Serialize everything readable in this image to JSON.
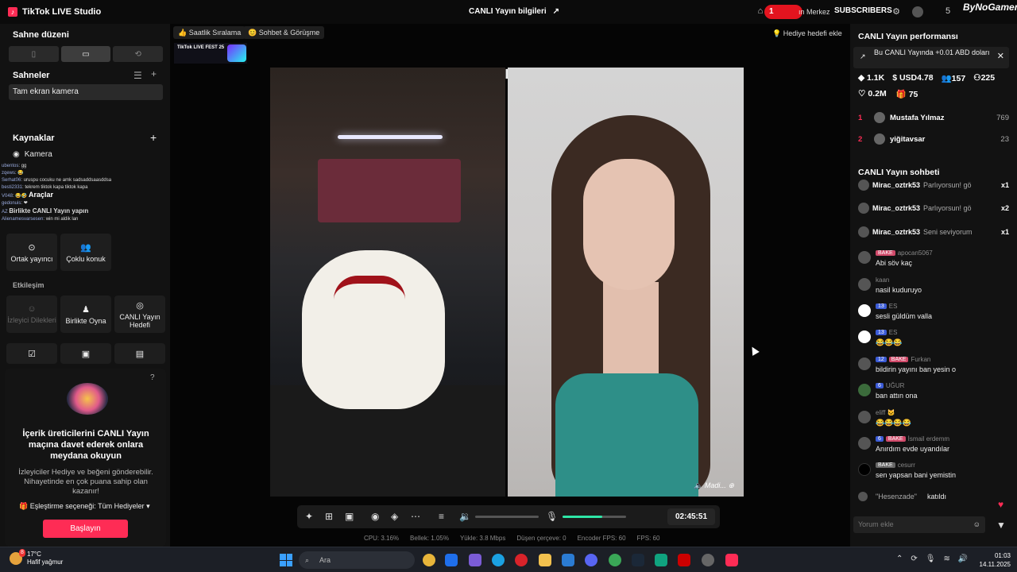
{
  "app": {
    "title": "TikTok LIVE Studio",
    "live_info": "CANLI Yayın bilgileri",
    "rec_badge": "1",
    "center_link": "ın Merkez",
    "subscribers": "SUBSCRIBERS",
    "count_badge": "5",
    "brand": "ByNoGamer"
  },
  "left": {
    "layout_title": "Sahne düzeni",
    "scenes_title": "Sahneler",
    "scene_item": "Tam ekran kamera",
    "sources_title": "Kaynaklar",
    "source_camera": "Kamera",
    "tools_title": "Araçlar",
    "together_title": "Birlikte CANLI Yayın yapın",
    "tools_row1": [
      "Ortak yayıncı",
      "Çoklu konuk"
    ],
    "interaction_title": "Etkileşim",
    "tools_row2": [
      "İzleyici Dilekleri",
      "Birlikte Oyna",
      "CANLI Yayın Hedefi"
    ],
    "overlay_chat": [
      {
        "user": "ubentos",
        "text": "gg"
      },
      {
        "user": "zqews",
        "text": "😂"
      },
      {
        "user": "Serhat06",
        "text": "uruspu cocuku ne amk sadsaddsaasddsa"
      },
      {
        "user": "besti2331",
        "text": "tekrem tiktok kapa tiktok kapa"
      },
      {
        "user": "V048",
        "text": "😂🤣"
      },
      {
        "user": "gedonuis",
        "text": "❤"
      },
      {
        "user": "AZ",
        "text": ""
      },
      {
        "user": "Alienamesvarsesen",
        "text": "win mi aldik lan"
      }
    ],
    "promo": {
      "title": "İçerik üreticilerini CANLI Yayın maçına davet ederek onlara meydana okuyun",
      "body": "İzleyiciler Hediye ve beğeni gönderebilir. Nihayetinde en çok puana sahip olan kazanır!",
      "match_option": "Eşleştirme seçeneği: Tüm Hediyeler",
      "start": "Başlayın"
    }
  },
  "stage": {
    "chip_hourly": "Saatlik Sıralama",
    "chip_chat": "Sohbet & Görüşme",
    "gift_goal": "Hediye hedefi ekle",
    "fest": "TikTok LIVE FEST 25",
    "guest_caption": "Madi...",
    "timer": "02:45:51",
    "mic_level": 0.62,
    "stats": [
      "CPU: 3.16%",
      "Bellek: 1.05%",
      "Yükle: 3.8 Mbps",
      "Düşen çerçeve: 0",
      "Encoder FPS: 60",
      "FPS: 60"
    ]
  },
  "right": {
    "perf_title": "CANLI Yayın performansı",
    "perf_notice": "Bu CANLI Yayında +0.01 ABD doları",
    "metrics": [
      "1.1K",
      "USD4.78",
      "157",
      "225"
    ],
    "metrics2": [
      "0.2M",
      "75"
    ],
    "ranks": [
      {
        "n": "1",
        "name": "Mustafa Yılmaz",
        "val": "769"
      },
      {
        "n": "2",
        "name": "yiğitavsar",
        "val": "23"
      }
    ],
    "chat_title": "CANLI Yayın sohbeti",
    "pinned": [
      {
        "user": "Mirac_oztrk53",
        "text": "Parlıyorsun! gö",
        "x": "x1"
      },
      {
        "user": "Mirac_oztrk53",
        "text": "Parlıyorsun! gö",
        "x": "x2"
      },
      {
        "user": "Mirac_oztrk53",
        "text": "Seni seviyorum",
        "x": "x1"
      }
    ],
    "messages": [
      {
        "lvl": "",
        "badge": "BAKE",
        "user": "apocan5067",
        "text": "Abi söv kaç"
      },
      {
        "lvl": "",
        "badge": "",
        "user": "kaan",
        "text": "nasil kuduruyo"
      },
      {
        "lvl": "13",
        "badge": "",
        "user": "ES",
        "text": "sesli güldüm valla"
      },
      {
        "lvl": "13",
        "badge": "",
        "user": "ES",
        "text": "😂😂😂"
      },
      {
        "lvl": "12",
        "badge": "BAKE",
        "user": "Furkan",
        "text": "bildirin yayını ban yesin o"
      },
      {
        "lvl": "6",
        "badge": "",
        "user": "UĞUR",
        "text": "ban attın ona"
      },
      {
        "lvl": "",
        "badge": "",
        "user": "eliff 🐱",
        "text": "😂😂😂😂"
      },
      {
        "lvl": "6",
        "badge": "BAKE",
        "user": "İsmail erdemm",
        "text": "Anırdım evde uyandılar"
      },
      {
        "lvl": "",
        "badge": "BAKE",
        "user": "cesurr",
        "text": "sen yapsan bani yemistin"
      },
      {
        "lvl": "",
        "badge": "",
        "user": "\"Hesenzade\"",
        "text": "katıldı"
      }
    ],
    "comment_placeholder": "Yorum ekle"
  },
  "taskbar": {
    "temp": "17°C",
    "weather": "Hafif yağmur",
    "weather_badge": "8",
    "search": "Ara",
    "time": "01:03",
    "date": "14.11.2025"
  },
  "colors": {
    "accent": "#fe2c55",
    "mic": "#2ee6a6"
  }
}
